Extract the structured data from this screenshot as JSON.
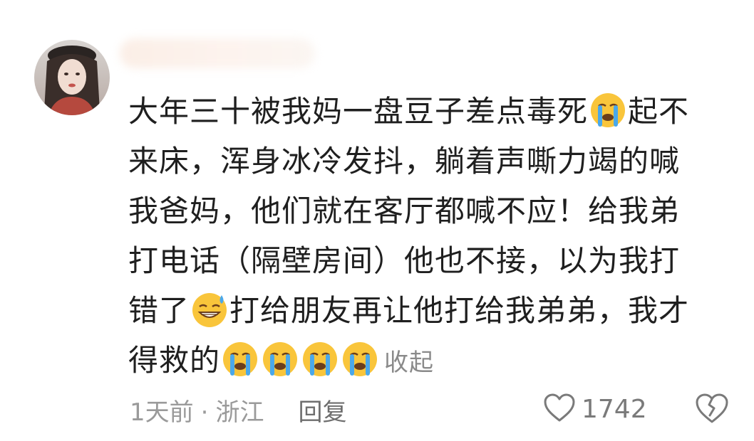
{
  "comment": {
    "lines": [
      "大年三十被我妈一盘豆子差点毒死",
      "起不",
      "来床，浑身冰冷发抖，躺着声嘶力竭的喊",
      "我爸妈，他们就在客厅都喊不应！给我弟",
      "打电话（隔壁房间）他也不接，以为我打",
      "错了",
      "打给朋友再让他打给我弟弟，我才",
      "得救的"
    ],
    "collapse_label": "收起"
  },
  "meta": {
    "time": "1天前",
    "separator": "·",
    "location": "浙江",
    "reply_label": "回复"
  },
  "actions": {
    "like_count": "1742"
  },
  "colors": {
    "text": "#1f1f1f",
    "meta": "#9a9a9a",
    "emoji_face": "#f9c53b"
  },
  "icons": [
    "avatar",
    "loudly-crying-face-icon",
    "grinning-sweat-face-icon",
    "heart-outline-icon",
    "broken-heart-icon"
  ]
}
